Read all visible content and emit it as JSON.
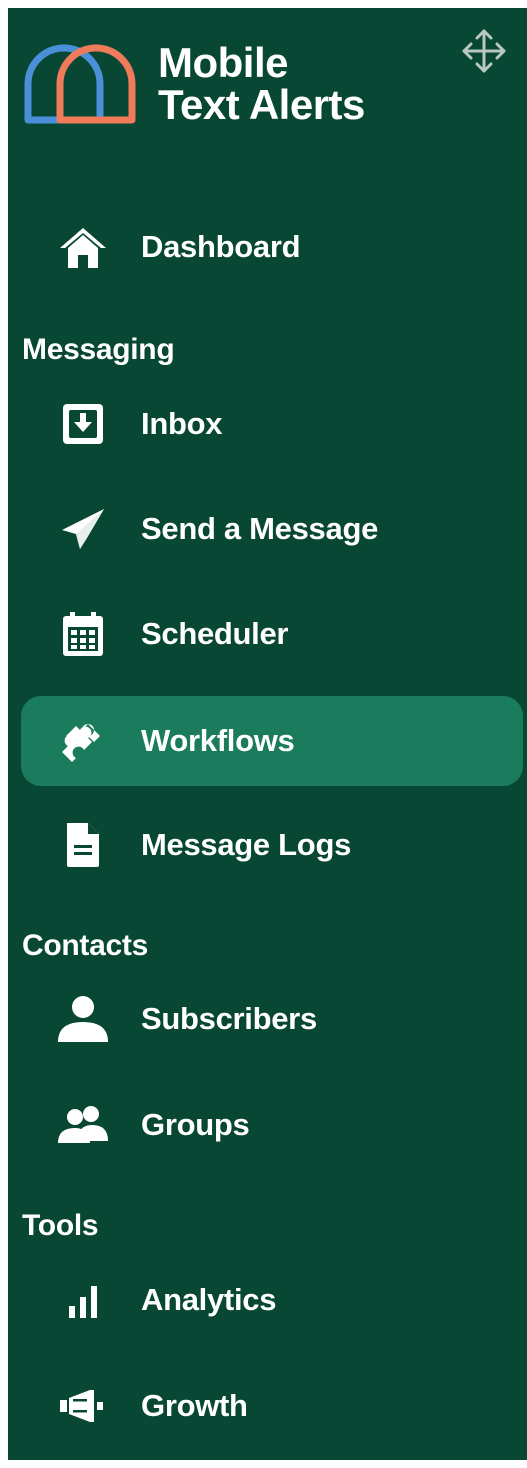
{
  "brand": {
    "line1": "Mobile",
    "line2": "Text Alerts",
    "colors": {
      "blue": "#4a90d9",
      "orange": "#ef7b5a",
      "background": "#084734",
      "active": "#1b7c5d"
    }
  },
  "nav": {
    "dashboard": {
      "label": "Dashboard",
      "icon": "home-icon"
    },
    "messaging_header": "Messaging",
    "inbox": {
      "label": "Inbox",
      "icon": "inbox-icon"
    },
    "send_message": {
      "label": "Send a Message",
      "icon": "paper-plane-icon"
    },
    "scheduler": {
      "label": "Scheduler",
      "icon": "calendar-icon"
    },
    "workflows": {
      "label": "Workflows",
      "icon": "puzzle-icon",
      "active": true
    },
    "message_logs": {
      "label": "Message Logs",
      "icon": "document-icon"
    },
    "contacts_header": "Contacts",
    "subscribers": {
      "label": "Subscribers",
      "icon": "user-icon"
    },
    "groups": {
      "label": "Groups",
      "icon": "users-icon"
    },
    "tools_header": "Tools",
    "analytics": {
      "label": "Analytics",
      "icon": "bar-chart-icon"
    },
    "growth": {
      "label": "Growth",
      "icon": "megaphone-icon"
    }
  }
}
